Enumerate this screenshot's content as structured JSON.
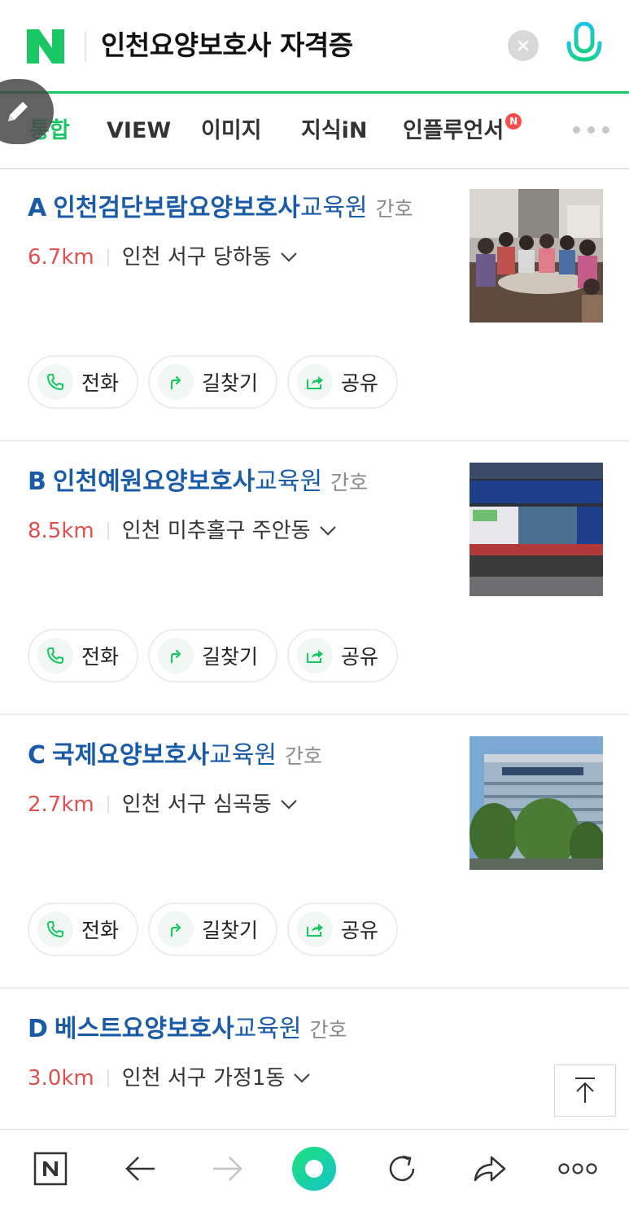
{
  "search": {
    "logo": "N",
    "query": "인천요양보호사 자격증",
    "clear_icon": "close-icon",
    "mic_icon": "microphone-icon"
  },
  "colors": {
    "brand_green": "#19c764",
    "title_blue": "#1a5ba8",
    "distance_red": "#e05050",
    "category_gray": "#8a8a8a"
  },
  "tabs": [
    {
      "label": "통합",
      "active": true
    },
    {
      "label": "VIEW",
      "active": false
    },
    {
      "label": "이미지",
      "active": false
    },
    {
      "label": "지식iN",
      "active": false
    },
    {
      "label": "인플루언서",
      "active": false,
      "badge": "N"
    }
  ],
  "results": [
    {
      "letter": "A",
      "name_pre": "인천검단보람",
      "name_bold": "요양보호사",
      "name_post": "교육원",
      "category": "간호",
      "distance": "6.7km",
      "address": "인천 서구 당하동",
      "thumb": "group-photo"
    },
    {
      "letter": "B",
      "name_pre": "인천예원",
      "name_bold": "요양보호사",
      "name_post": "교육원",
      "category": "간호",
      "distance": "8.5km",
      "address": "인천 미추홀구 주안동",
      "thumb": "building-signboard"
    },
    {
      "letter": "C",
      "name_pre": "국제",
      "name_bold": "요양보호사",
      "name_post": "교육원",
      "category": "간호",
      "distance": "2.7km",
      "address": "인천 서구 심곡동",
      "thumb": "building-exterior"
    },
    {
      "letter": "D",
      "name_pre": "베스트",
      "name_bold": "요양보호사",
      "name_post": "교육원",
      "category": "간호",
      "distance": "3.0km",
      "address": "인천 서구 가정1동",
      "thumb": ""
    }
  ],
  "actions": {
    "call": "전화",
    "directions": "길찾기",
    "share": "공유"
  },
  "bottom_nav": [
    "naver-home-icon",
    "back-arrow-icon",
    "forward-arrow-icon",
    "green-dot-icon",
    "refresh-icon",
    "share-icon",
    "more-icon"
  ]
}
